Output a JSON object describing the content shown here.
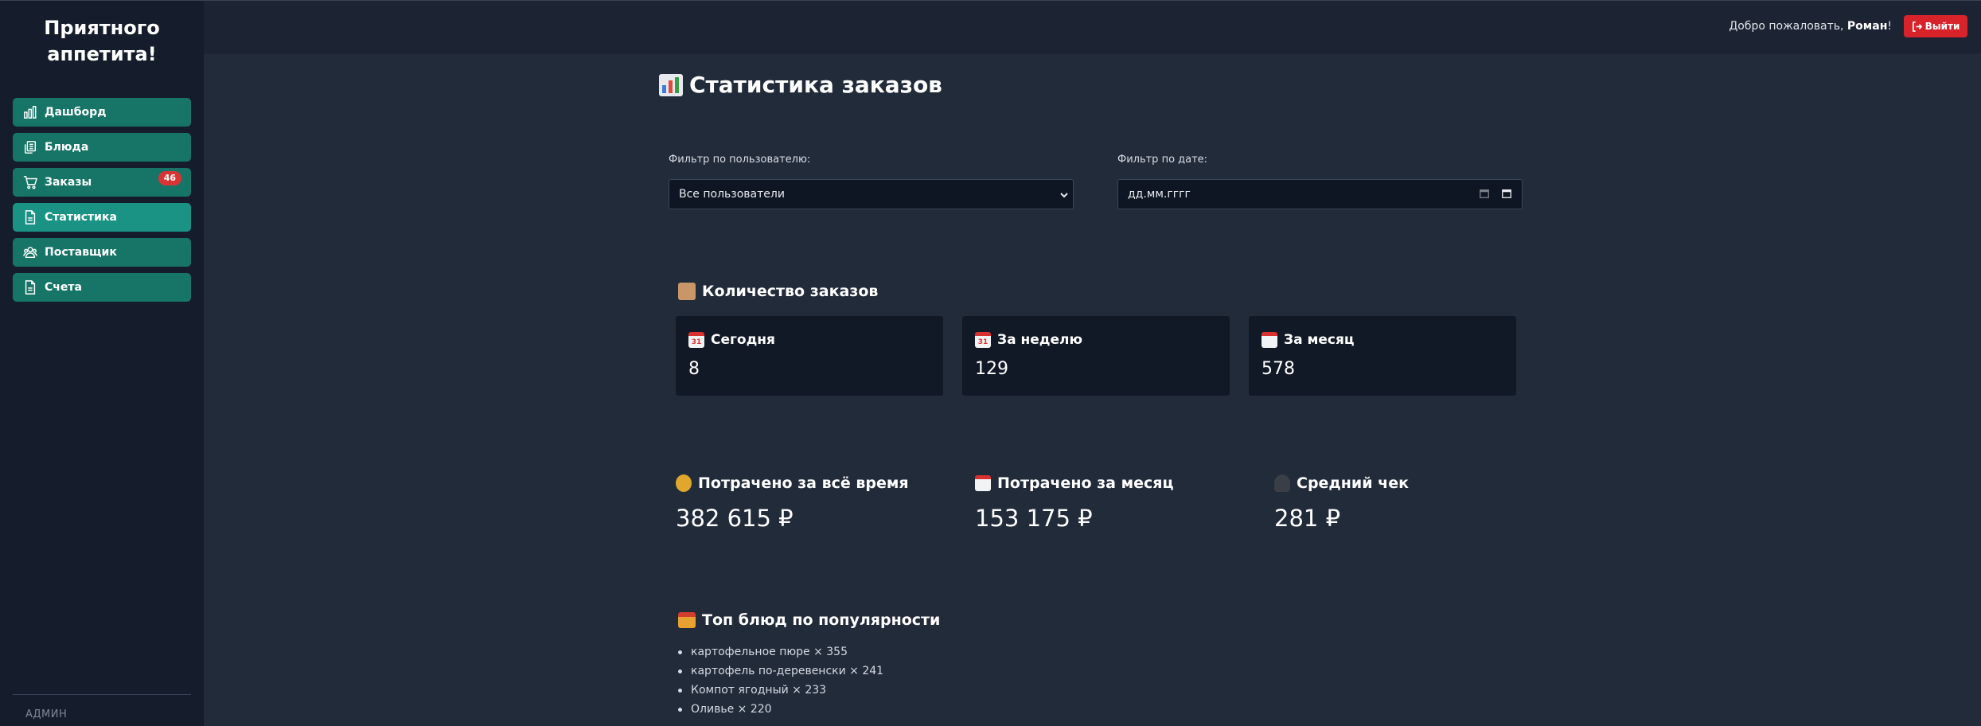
{
  "sidebar": {
    "brand_line1": "Приятного",
    "brand_line2": "аппетита!",
    "items": [
      {
        "label": "Дашборд",
        "icon": "bar-chart-icon"
      },
      {
        "label": "Блюда",
        "icon": "copy-icon"
      },
      {
        "label": "Заказы",
        "icon": "cart-icon",
        "badge": "46"
      },
      {
        "label": "Статистика",
        "icon": "document-icon",
        "active": true
      },
      {
        "label": "Поставщик",
        "icon": "users-icon"
      },
      {
        "label": "Счета",
        "icon": "document-icon"
      }
    ],
    "role": "АДМИН"
  },
  "header": {
    "welcome_prefix": "Добро пожаловать, ",
    "user_name": "Роман",
    "welcome_suffix": "!",
    "logout_label": "Выйти"
  },
  "page": {
    "title": "Статистика заказов",
    "filters": {
      "user_label": "Фильтр по пользователю:",
      "user_value": "Все пользователи",
      "date_label": "Фильтр по дате:",
      "date_value": "дд.мм.гггг"
    },
    "orders_count": {
      "title": "Количество заказов",
      "cards": [
        {
          "label": "Сегодня",
          "value": "8"
        },
        {
          "label": "За неделю",
          "value": "129"
        },
        {
          "label": "За месяц",
          "value": "578"
        }
      ]
    },
    "spending": [
      {
        "label": "Потрачено за всё время",
        "value": "382 615 ₽",
        "icon": "money-bag-icon"
      },
      {
        "label": "Потрачено за месяц",
        "value": "153 175 ₽",
        "icon": "calendar-icon"
      },
      {
        "label": "Средний чек",
        "value": "281 ₽",
        "icon": "person-icon"
      }
    ],
    "top_dishes": {
      "title": "Топ блюд по популярности",
      "items": [
        "картофельное пюре × 355",
        "картофель по-деревенски × 241",
        "Компот ягодный × 233",
        "Оливье × 220"
      ]
    }
  },
  "colors": {
    "background": "#222b3a",
    "sidebar": "#151d2c",
    "nav_item": "#177567",
    "nav_active": "#1a9384",
    "badge": "#d83434",
    "logout": "#d8232a",
    "card": "#111826"
  }
}
